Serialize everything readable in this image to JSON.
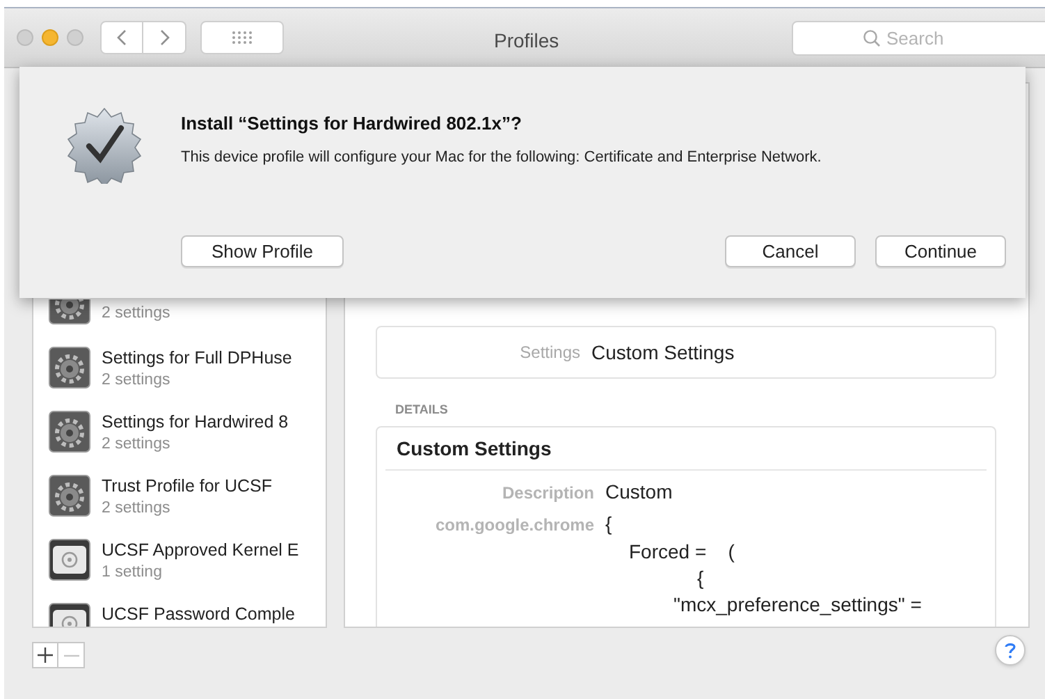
{
  "window": {
    "title": "Profiles",
    "search_placeholder": "Search"
  },
  "sheet": {
    "title": "Install “Settings for Hardwired 802.1x”?",
    "message": "This device profile will configure your Mac for the following: Certificate and Enterprise Network.",
    "left_buttons": [
      "Show Profile"
    ],
    "right_buttons": [
      "Cancel",
      "Continue"
    ]
  },
  "profiles": [
    {
      "kind": "gear",
      "subtitle": "2 settings"
    },
    {
      "kind": "gear",
      "title": "Settings for Full DPHuse",
      "subtitle": "2 settings"
    },
    {
      "kind": "gear",
      "title": "Settings for Hardwired 8",
      "subtitle": "2 settings"
    },
    {
      "kind": "gear",
      "title": "Trust Profile for UCSF",
      "subtitle": "2 settings"
    },
    {
      "kind": "disk",
      "title": "UCSF Approved Kernel E",
      "subtitle": "1 setting"
    },
    {
      "kind": "disk",
      "title": "UCSF Password Comple"
    }
  ],
  "detail": {
    "summary": {
      "label": "Settings",
      "value": "Custom Settings"
    },
    "section_label": "DETAILS",
    "card_title": "Custom Settings",
    "rows": [
      {
        "label": "Description",
        "value": "Custom"
      },
      {
        "label": "com.google.chrome",
        "value": "{"
      }
    ],
    "code_lines": [
      "Forced =    (",
      "{",
      "\"mcx_preference_settings\" ="
    ]
  }
}
